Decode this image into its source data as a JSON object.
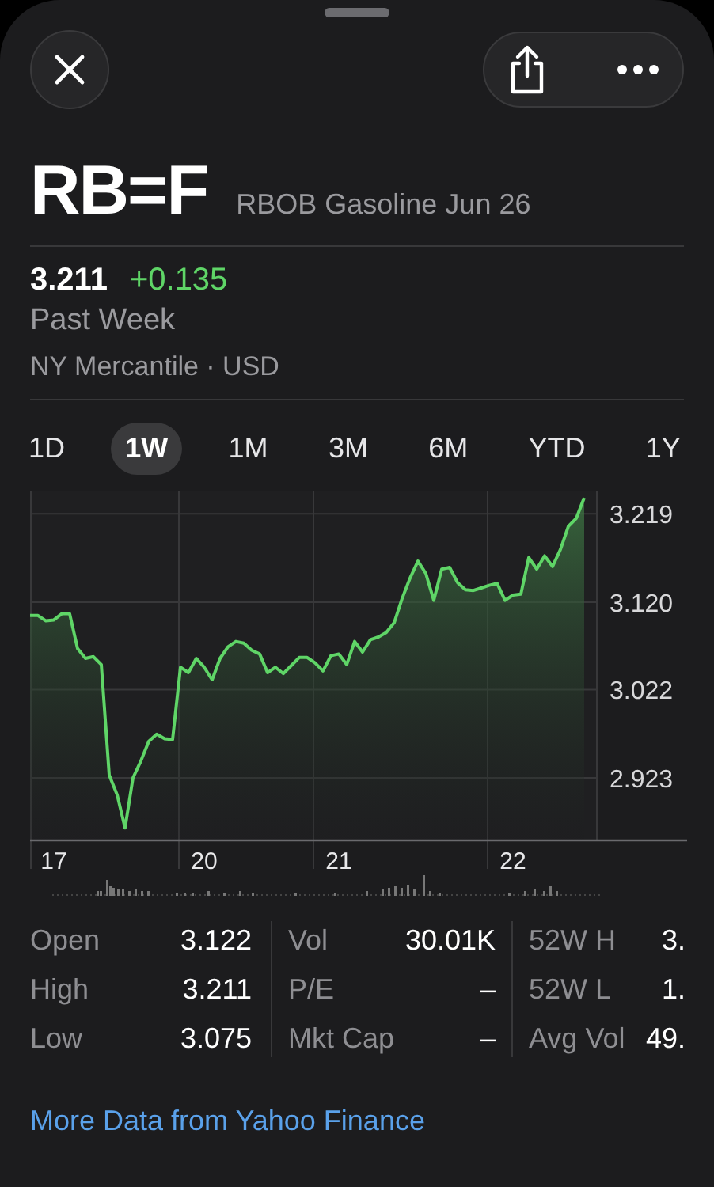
{
  "header": {
    "symbol": "RB=F",
    "name": "RBOB Gasoline Jun 26"
  },
  "quote": {
    "price": "3.211",
    "change": "+0.135",
    "period": "Past Week",
    "exchange": "NY Mercantile · USD"
  },
  "ranges": [
    {
      "label": "1D",
      "selected": false
    },
    {
      "label": "1W",
      "selected": true
    },
    {
      "label": "1M",
      "selected": false
    },
    {
      "label": "3M",
      "selected": false
    },
    {
      "label": "6M",
      "selected": false
    },
    {
      "label": "YTD",
      "selected": false
    },
    {
      "label": "1Y",
      "selected": false
    }
  ],
  "chart": {
    "chart_data": {
      "type": "area",
      "ylim": [
        2.853,
        3.245
      ],
      "grid": true,
      "categories": [
        null,
        null,
        null,
        "17",
        null,
        null,
        null,
        null,
        null,
        null,
        null,
        null,
        null,
        null,
        null,
        null,
        null,
        null,
        null,
        null,
        null,
        null,
        "20",
        null,
        null,
        null,
        null,
        null,
        null,
        null,
        null,
        null,
        null,
        null,
        null,
        null,
        null,
        null,
        null,
        "21",
        null,
        null,
        null,
        null,
        null,
        null,
        null,
        null,
        null,
        null,
        null,
        null,
        null,
        null,
        null,
        null,
        null,
        null,
        null,
        null,
        null,
        "22",
        null,
        null,
        null,
        null,
        null,
        null,
        null,
        null,
        null
      ],
      "yticks": [
        {
          "value": 3.219,
          "label": "3.219"
        },
        {
          "value": 3.12,
          "label": "3.120"
        },
        {
          "value": 3.022,
          "label": "3.022"
        },
        {
          "value": 2.923,
          "label": "2.923"
        }
      ],
      "values": [
        3.105,
        3.105,
        3.099,
        3.1,
        3.107,
        3.107,
        3.068,
        3.057,
        3.059,
        3.05,
        2.926,
        2.904,
        2.867,
        2.923,
        2.942,
        2.964,
        2.972,
        2.967,
        2.966,
        3.047,
        3.041,
        3.057,
        3.047,
        3.033,
        3.057,
        3.07,
        3.076,
        3.074,
        3.066,
        3.062,
        3.041,
        3.047,
        3.04,
        3.049,
        3.058,
        3.058,
        3.052,
        3.043,
        3.06,
        3.062,
        3.05,
        3.076,
        3.064,
        3.078,
        3.081,
        3.086,
        3.097,
        3.124,
        3.147,
        3.166,
        3.152,
        3.122,
        3.157,
        3.159,
        3.142,
        3.134,
        3.133,
        3.136,
        3.139,
        3.141,
        3.122,
        3.128,
        3.129,
        3.17,
        3.157,
        3.172,
        3.16,
        3.179,
        3.205,
        3.214,
        3.237
      ]
    }
  },
  "stats": [
    [
      {
        "label": "Open",
        "value": "3.122"
      },
      {
        "label": "High",
        "value": "3.211"
      },
      {
        "label": "Low",
        "value": "3.075"
      }
    ],
    [
      {
        "label": "Vol",
        "value": "30.01K"
      },
      {
        "label": "P/E",
        "value": "–"
      },
      {
        "label": "Mkt Cap",
        "value": "–"
      }
    ],
    [
      {
        "label": "52W H",
        "value": "3."
      },
      {
        "label": "52W L",
        "value": "1."
      },
      {
        "label": "Avg Vol",
        "value": "49."
      }
    ]
  ],
  "link": "More Data from Yahoo Finance"
}
